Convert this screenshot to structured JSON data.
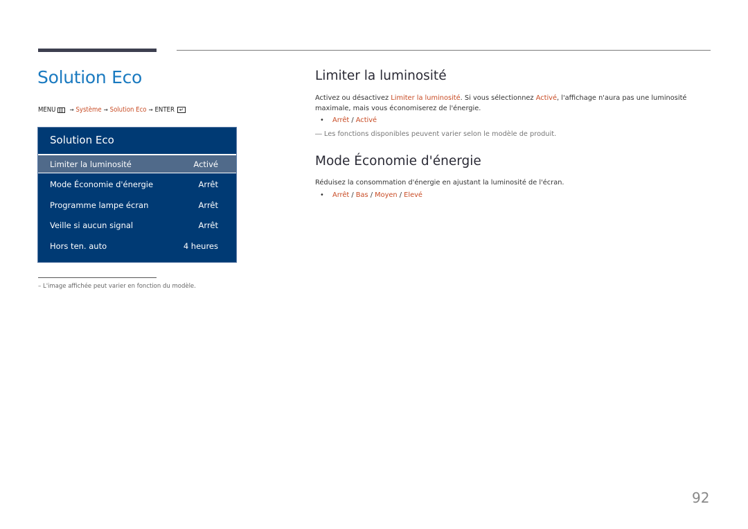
{
  "page": {
    "title": "Solution Eco",
    "page_number": "92"
  },
  "breadcrumb": {
    "menu": "MENU",
    "menu_icon": "menu-grid-icon",
    "arrow": "→",
    "item1": "Système",
    "item2": "Solution Eco",
    "enter": "ENTER",
    "enter_icon": "enter-icon",
    "enter_glyph": "↵"
  },
  "osd_menu": {
    "title": "Solution Eco",
    "items": [
      {
        "label": "Limiter la luminosité",
        "value": "Activé",
        "selected": true
      },
      {
        "label": "Mode Économie d'énergie",
        "value": "Arrêt"
      },
      {
        "label": "Programme lampe écran",
        "value": "Arrêt"
      },
      {
        "label": "Veille si aucun signal",
        "value": "Arrêt"
      },
      {
        "label": "Hors ten. auto",
        "value": "4 heures"
      }
    ]
  },
  "footnote": "–  L'image affichée peut varier en fonction du modèle.",
  "sections": [
    {
      "heading": "Limiter la luminosité",
      "para_parts": [
        "Activez ou désactivez ",
        "Limiter la luminosité",
        ". Si vous sélectionnez ",
        "Activé",
        ", l'affichage n'aura pas une luminosité maximale, mais vous économiserez de l'énergie."
      ],
      "bullet_dot": "•",
      "options": [
        "Arrêt",
        "Activé"
      ],
      "note": "Les fonctions disponibles peuvent varier selon le modèle de produit.",
      "note_mark": "―"
    },
    {
      "heading": "Mode Économie d'énergie",
      "para": "Réduisez la consommation d'énergie en ajustant la luminosité de l'écran.",
      "bullet_dot": "•",
      "options": [
        "Arrêt",
        "Bas",
        "Moyen",
        "Elevé"
      ]
    }
  ],
  "separator": " / ",
  "colors": {
    "title_blue": "#1a7ac0",
    "accent_red": "#c84b24",
    "osd_bg": "#003a74",
    "osd_selected": "#506a8a"
  }
}
